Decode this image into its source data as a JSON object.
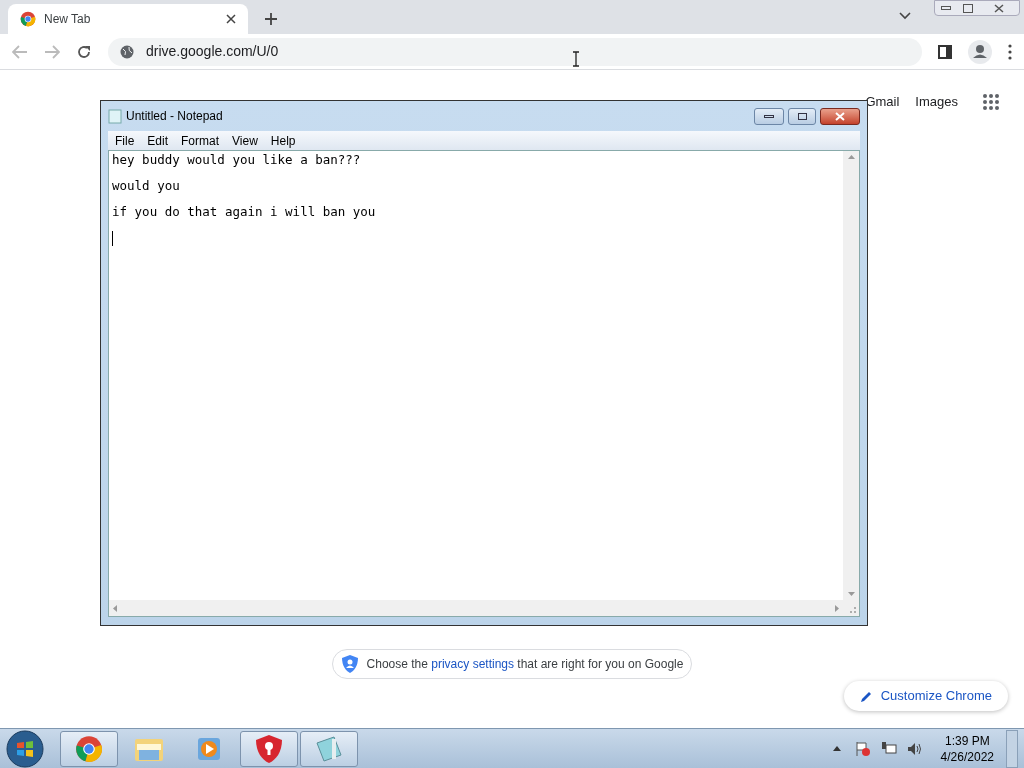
{
  "browser": {
    "tabs": [
      {
        "title": "New Tab",
        "selected": true
      }
    ],
    "address": "drive.google.com/U/0"
  },
  "page": {
    "header_links": [
      "Gmail",
      "Images"
    ],
    "privacy_notice": {
      "before": "Choose the",
      "link": "privacy settings",
      "after": "that are right for you on Google"
    },
    "customize_button": "Customize Chrome"
  },
  "notepad": {
    "title": "Untitled - Notepad",
    "menu": [
      "File",
      "Edit",
      "Format",
      "View",
      "Help"
    ],
    "lines": [
      "hey buddy would you like a ban???",
      "would you",
      "if you do that again i will ban you"
    ]
  },
  "taskbar": {
    "items": [
      {
        "kind": "chrome",
        "running": true
      },
      {
        "kind": "explorer",
        "running": false
      },
      {
        "kind": "media",
        "running": false
      },
      {
        "kind": "shield",
        "running": true
      },
      {
        "kind": "notepad",
        "running": true
      }
    ],
    "time": "1:39 PM",
    "date": "4/26/2022"
  }
}
